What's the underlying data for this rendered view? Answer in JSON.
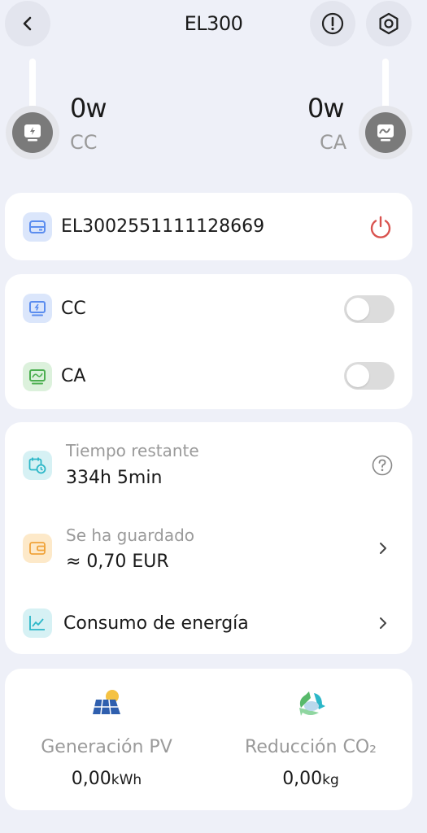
{
  "header": {
    "title": "EL300",
    "back_icon": "chevron-left-icon",
    "info_icon": "alert-circle-icon",
    "settings_icon": "gear-icon"
  },
  "outputs": {
    "dc": {
      "value": "0w",
      "label": "CC",
      "icon": "dc-port-icon"
    },
    "ac": {
      "value": "0w",
      "label": "CA",
      "icon": "ac-port-icon"
    }
  },
  "device": {
    "serial": "EL3002551111128669",
    "icon": "battery-icon",
    "power_icon": "power-icon",
    "power_color": "#d9534f"
  },
  "switches": {
    "dc": {
      "label": "CC",
      "on": false,
      "icon": "dc-output-icon",
      "color": "#5b8def"
    },
    "ac": {
      "label": "CA",
      "on": false,
      "icon": "ac-output-icon",
      "color": "#4caf50"
    }
  },
  "info": {
    "remaining": {
      "label": "Tiempo restante",
      "value": "334h 5min",
      "icon": "calendar-clock-icon"
    },
    "saved": {
      "label": "Se ha guardado",
      "value": "≈ 0,70 EUR",
      "icon": "wallet-icon"
    },
    "consumption": {
      "label": "Consumo de energía",
      "icon": "line-chart-icon"
    }
  },
  "stats": {
    "pv": {
      "label": "Generación PV",
      "value": "0,00",
      "unit": "kWh",
      "icon": "solar-panel-icon"
    },
    "co2": {
      "label": "Reducción CO₂",
      "value": "0,00",
      "unit": "kg",
      "icon": "recycle-leaf-icon"
    }
  },
  "colors": {
    "background": "#eef0f8",
    "accent_blue": "#5b8def",
    "accent_green": "#4caf50",
    "accent_orange": "#f0a33a",
    "accent_teal": "#2cb7c8"
  }
}
